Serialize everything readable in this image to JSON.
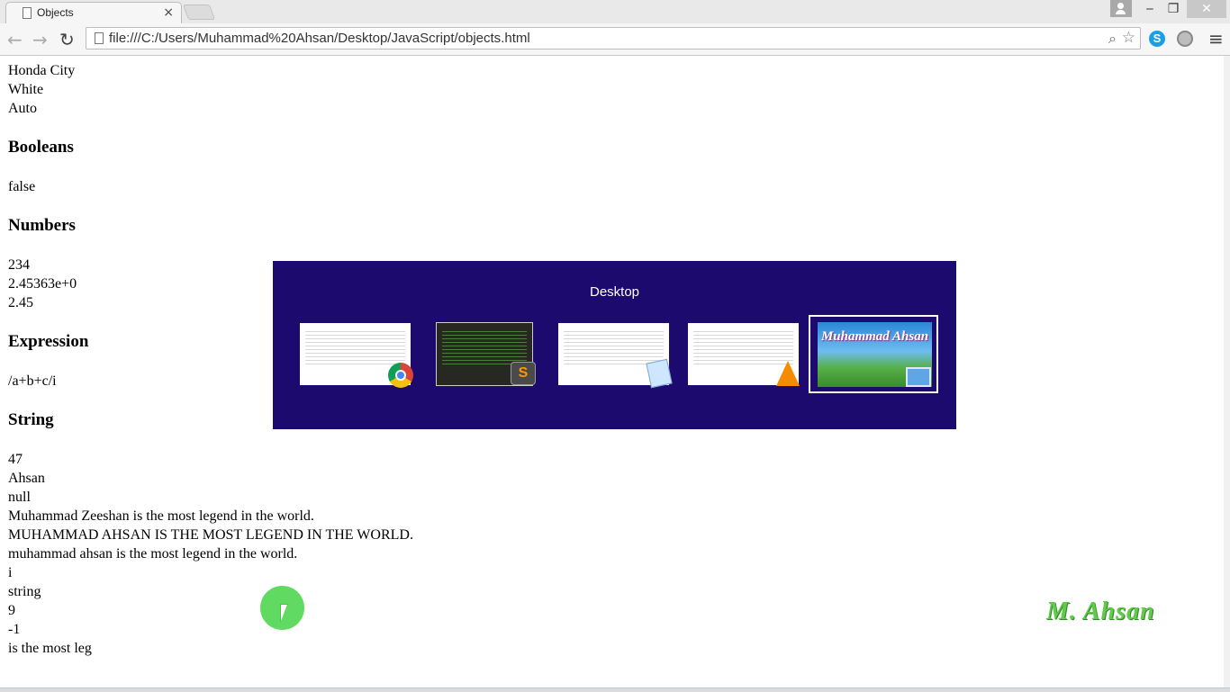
{
  "browser": {
    "tab_title": "Objects",
    "tab_close": "×",
    "url": "file:///C:/Users/Muhammad%20Ahsan/Desktop/JavaScript/objects.html",
    "window_controls": {
      "minimize": "‒",
      "restore": "❐",
      "close": "✕"
    },
    "back": "←",
    "forward": "→",
    "reload": "↻",
    "zoom_icon": "⌕",
    "star_icon": "☆",
    "skype_letter": "S",
    "menu_icon": "≡"
  },
  "page": {
    "car_lines": [
      "Honda City",
      "White",
      "Auto"
    ],
    "booleans_heading": "Booleans",
    "booleans_lines": [
      "false"
    ],
    "numbers_heading": "Numbers",
    "numbers_lines": [
      "234",
      "2.45363e+0",
      "2.45"
    ],
    "expression_heading": "Expression",
    "expression_lines": [
      "/a+b+c/i"
    ],
    "string_heading": "String",
    "string_lines": [
      "47",
      "Ahsan",
      "null",
      "Muhammad Zeeshan is the most legend in the world.",
      "MUHAMMAD AHSAN IS THE MOST LEGEND IN THE WORLD.",
      "muhammad ahsan is the most legend in the world.",
      "i",
      "string",
      "9",
      "-1",
      "is the most leg"
    ]
  },
  "switcher": {
    "label": "Desktop",
    "selected_thumb_text": "Muhammad Ahsan",
    "apps": [
      "chrome-icon",
      "sublime-icon",
      "notepad-icon",
      "vlc-icon",
      "desktop-icon"
    ],
    "sublime_letter": "S"
  },
  "watermark": "M. Ahsan"
}
